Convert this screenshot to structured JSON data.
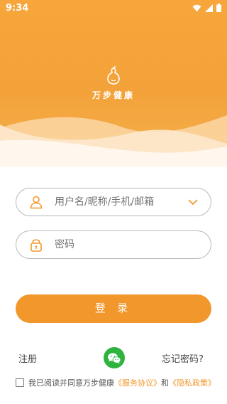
{
  "status_bar": {
    "time": "9:34"
  },
  "brand": {
    "name": "万步健康"
  },
  "form": {
    "username_placeholder": "用户名/昵称/手机/邮箱",
    "password_placeholder": "密码",
    "login_label": "登 录"
  },
  "links": {
    "register": "注册",
    "forgot_password": "忘记密码?"
  },
  "agreement": {
    "prefix": "我已阅读并同意万步健康",
    "service_link": "《服务协议》",
    "joiner": "和",
    "privacy_link": "《隐私政策》",
    "checked": false
  },
  "colors": {
    "brand_orange": "#f2972b",
    "wechat_green": "#2db33e"
  },
  "icons": {
    "user": "person-outline-icon",
    "lock": "lock-icon",
    "dropdown": "chevron-down-icon",
    "wechat": "wechat-icon"
  }
}
